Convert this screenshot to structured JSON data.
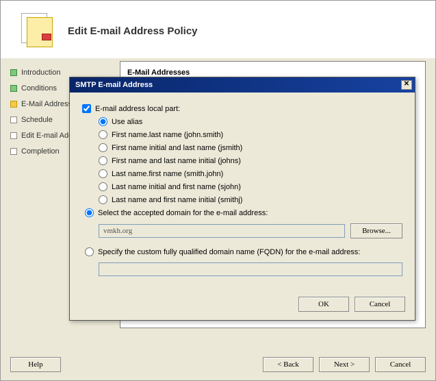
{
  "wizard": {
    "title": "Edit E-mail Address Policy",
    "section": "E-Mail Addresses",
    "steps": [
      {
        "label": "Introduction",
        "state": "done"
      },
      {
        "label": "Conditions",
        "state": "done"
      },
      {
        "label": "E-Mail Addresses",
        "state": "active"
      },
      {
        "label": "Schedule",
        "state": "pending"
      },
      {
        "label": "Edit E-mail Address Policy",
        "state": "pending"
      },
      {
        "label": "Completion",
        "state": "pending"
      }
    ],
    "buttons": {
      "help": "Help",
      "back": "< Back",
      "next": "Next >",
      "cancel": "Cancel"
    }
  },
  "dialog": {
    "title": "SMTP E-mail Address",
    "localPartCheckbox": "E-mail address local part:",
    "localPartOptions": [
      "Use alias",
      "First name.last name (john.smith)",
      "First name initial and last name (jsmith)",
      "First name and last name initial (johns)",
      "Last name.first name (smith.john)",
      "Last name initial and first name (sjohn)",
      "Last name and first name initial (smithj)"
    ],
    "selectAccepted": "Select the accepted domain for the e-mail address:",
    "domainValue": "vmkh.org",
    "browse": "Browse...",
    "specifyFqdn": "Specify the custom fully qualified domain name (FQDN) for the e-mail address:",
    "fqdnValue": "",
    "ok": "OK",
    "cancel": "Cancel"
  }
}
